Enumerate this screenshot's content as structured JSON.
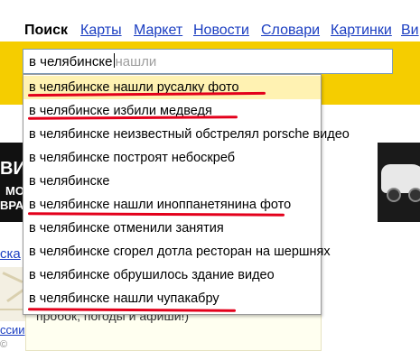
{
  "nav": {
    "items": [
      {
        "label": "Поиск",
        "active": true
      },
      {
        "label": "Карты",
        "active": false
      },
      {
        "label": "Маркет",
        "active": false
      },
      {
        "label": "Новости",
        "active": false
      },
      {
        "label": "Словари",
        "active": false
      },
      {
        "label": "Картинки",
        "active": false
      },
      {
        "label": "Ви",
        "active": false
      }
    ]
  },
  "search": {
    "typed": "в челябинске",
    "hint": "нашли"
  },
  "suggestions": [
    {
      "text": "в челябинске нашли русалку фото",
      "underlined": true,
      "highlighted": true
    },
    {
      "text": "в челябинске избили медведя",
      "underlined": true,
      "highlighted": false
    },
    {
      "text": "в челябинске неизвестный обстрелял porsche видео",
      "underlined": false,
      "highlighted": false
    },
    {
      "text": "в челябинске построят небоскреб",
      "underlined": false,
      "highlighted": false
    },
    {
      "text": "в челябинске",
      "underlined": false,
      "highlighted": false
    },
    {
      "text": "в челябинске нашли иноппанетянина фото",
      "underlined": true,
      "highlighted": false
    },
    {
      "text": "в челябинске отменили занятия",
      "underlined": false,
      "highlighted": false
    },
    {
      "text": "в челябинске сгорел дотла ресторан на шершнях",
      "underlined": false,
      "highlighted": false
    },
    {
      "text": "в челябинске обрушилось здание видео",
      "underlined": false,
      "highlighted": false
    },
    {
      "text": "в челябинске нашли чупакабру",
      "underlined": true,
      "highlighted": false
    }
  ],
  "background": {
    "ad_left_lines": [
      "ВИР",
      "МО",
      "ВРА"
    ],
    "left_link": "ска",
    "behind_text": "пробок, погоды и афиши!)",
    "bottom_link": "ссии",
    "bottom_gray": "©"
  },
  "colors": {
    "link": "#1a3dc1",
    "search_bar": "#f5cd00",
    "underline": "#e3001b",
    "hint": "#9e9e9e"
  }
}
